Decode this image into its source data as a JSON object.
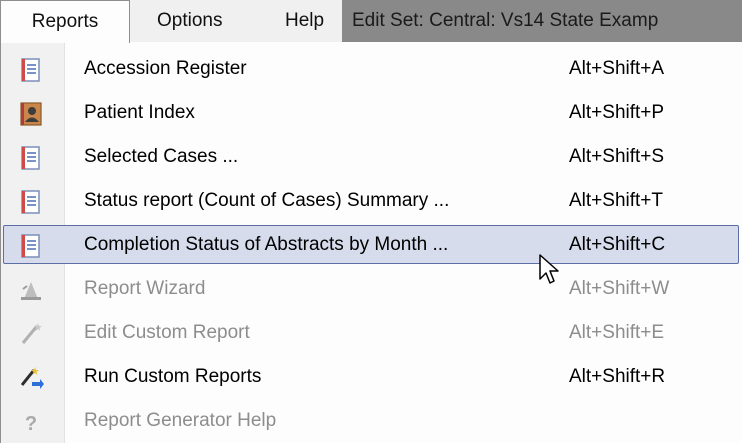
{
  "menubar": {
    "reports": "Reports",
    "options": "Options",
    "help": "Help",
    "edit_set": "Edit Set: Central: Vs14 State Examp"
  },
  "menu": {
    "items": [
      {
        "label": "Accession Register",
        "shortcut": "Alt+Shift+A",
        "icon": "report-icon",
        "enabled": true
      },
      {
        "label": "Patient Index",
        "shortcut": "Alt+Shift+P",
        "icon": "patient-index-icon",
        "enabled": true
      },
      {
        "label": "Selected Cases ...",
        "shortcut": "Alt+Shift+S",
        "icon": "report-icon",
        "enabled": true
      },
      {
        "label": "Status report (Count of Cases) Summary ...",
        "shortcut": "Alt+Shift+T",
        "icon": "report-icon",
        "enabled": true
      },
      {
        "label": "Completion Status of Abstracts by Month ...",
        "shortcut": "Alt+Shift+C",
        "icon": "report-icon",
        "enabled": true,
        "highlighted": true
      },
      {
        "label": "Report Wizard",
        "shortcut": "Alt+Shift+W",
        "icon": "wizard-hat-icon",
        "enabled": false
      },
      {
        "label": "Edit Custom Report",
        "shortcut": "Alt+Shift+E",
        "icon": "magic-wand-icon",
        "enabled": false
      },
      {
        "label": "Run Custom Reports",
        "shortcut": "Alt+Shift+R",
        "icon": "magic-wand-run-icon",
        "enabled": true
      },
      {
        "label": "Report Generator Help",
        "shortcut": "",
        "icon": "help-question-icon",
        "enabled": false
      }
    ]
  },
  "colors": {
    "highlight_bg": "#d6dcec",
    "highlight_border": "#5b6fa6",
    "disabled_text": "#8d8d8d",
    "edit_set_bg": "#898989"
  }
}
